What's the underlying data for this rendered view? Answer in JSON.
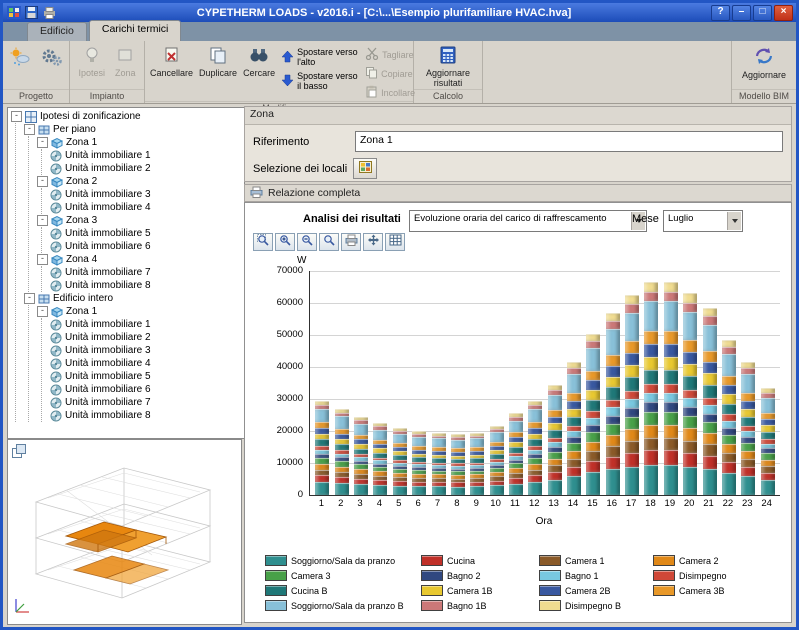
{
  "window": {
    "title": "CYPETHERM LOADS - v2016.i - [C:\\...\\Esempio plurifamiliare HVAC.hva]",
    "controls": {
      "help": "?",
      "minimize": "–",
      "maximize": "□",
      "close": "×"
    }
  },
  "tabs": [
    {
      "label": "Edificio"
    },
    {
      "label": "Carichi termici"
    }
  ],
  "ribbon": {
    "groups": [
      {
        "label": "Progetto"
      },
      {
        "label": "Impianto"
      },
      {
        "label": "Modifica"
      },
      {
        "label": "Calcolo"
      },
      {
        "label": "Modello BIM"
      }
    ],
    "buttons": {
      "ipotesi": "Ipotesi",
      "zona": "Zona",
      "cancellare": "Cancellare",
      "duplicare": "Duplicare",
      "cercare": "Cercare",
      "spostare_alto": "Spostare verso l'alto",
      "spostare_basso": "Spostare verso il basso",
      "tagliare": "Tagliare",
      "copiare": "Copiare",
      "incollare": "Incollare",
      "aggiornare_risultati": "Aggiornare risultati",
      "aggiornare_bim": "Aggiornare"
    }
  },
  "tree": {
    "root": {
      "label": "Ipotesi di zonificazione",
      "children": [
        {
          "label": "Per piano",
          "children": [
            {
              "label": "Zona 1",
              "children": [
                {
                  "label": "Unità immobiliare 1"
                },
                {
                  "label": "Unità immobiliare 2"
                }
              ]
            },
            {
              "label": "Zona 2",
              "children": [
                {
                  "label": "Unità immobiliare 3"
                },
                {
                  "label": "Unità immobiliare 4"
                }
              ]
            },
            {
              "label": "Zona 3",
              "children": [
                {
                  "label": "Unità immobiliare 5"
                },
                {
                  "label": "Unità immobiliare 6"
                }
              ]
            },
            {
              "label": "Zona 4",
              "children": [
                {
                  "label": "Unità immobiliare 7"
                },
                {
                  "label": "Unità immobiliare 8"
                }
              ]
            }
          ]
        },
        {
          "label": "Edificio intero",
          "children": [
            {
              "label": "Zona 1",
              "children": [
                {
                  "label": "Unità immobiliare 1"
                },
                {
                  "label": "Unità immobiliare 2"
                },
                {
                  "label": "Unità immobiliare 3"
                },
                {
                  "label": "Unità immobiliare 4"
                },
                {
                  "label": "Unità immobiliare 5"
                },
                {
                  "label": "Unità immobiliare 6"
                },
                {
                  "label": "Unità immobiliare 7"
                },
                {
                  "label": "Unità immobiliare 8"
                }
              ]
            }
          ]
        }
      ]
    }
  },
  "zona_panel": {
    "header": "Zona",
    "riferimento_label": "Riferimento",
    "riferimento_value": "Zona 1",
    "selezione_label": "Selezione dei locali"
  },
  "report": {
    "section_label": "Relazione completa",
    "analisi_label": "Analisi dei risultati",
    "analisi_value": "Evoluzione oraria del carico di raffrescamento",
    "mese_label": "Mese",
    "mese_value": "Luglio",
    "tools": [
      "zoom-window",
      "zoom-in",
      "zoom-out",
      "zoom-original",
      "print-chart",
      "pan",
      "export"
    ]
  },
  "chart_data": {
    "type": "bar",
    "stacked": true,
    "title": "",
    "ylabel": "W",
    "xlabel": "Ora",
    "ylim": [
      0,
      70000
    ],
    "ytick_step": 10000,
    "grid": true,
    "legend_position": "bottom",
    "categories": [
      1,
      2,
      3,
      4,
      5,
      6,
      7,
      8,
      9,
      10,
      11,
      12,
      13,
      14,
      15,
      16,
      17,
      18,
      19,
      20,
      21,
      22,
      23,
      24
    ],
    "totals": [
      29500,
      27000,
      24500,
      22500,
      21000,
      20000,
      19500,
      19000,
      19500,
      21500,
      25500,
      29500,
      34500,
      41500,
      50500,
      57000,
      62500,
      66500,
      66500,
      63000,
      58500,
      48500,
      41500,
      33500
    ],
    "series": [
      {
        "name": "Soggiorno/Sala da pranzo",
        "color": "#2f8f8f",
        "share": 0.14
      },
      {
        "name": "Cucina",
        "color": "#c03028",
        "share": 0.07
      },
      {
        "name": "Camera 1",
        "color": "#8a5a28",
        "share": 0.06
      },
      {
        "name": "Camera 2",
        "color": "#e08818",
        "share": 0.06
      },
      {
        "name": "Camera 3",
        "color": "#48a048",
        "share": 0.06
      },
      {
        "name": "Bagno 2",
        "color": "#304880",
        "share": 0.045
      },
      {
        "name": "Bagno 1",
        "color": "#78c8e0",
        "share": 0.045
      },
      {
        "name": "Disimpegno",
        "color": "#d04838",
        "share": 0.04
      },
      {
        "name": "Cucina B",
        "color": "#1f7878",
        "share": 0.07
      },
      {
        "name": "Camera 1B",
        "color": "#e8c830",
        "share": 0.06
      },
      {
        "name": "Camera 2B",
        "color": "#3858a0",
        "share": 0.06
      },
      {
        "name": "Camera 3B",
        "color": "#e89828",
        "share": 0.06
      },
      {
        "name": "Soggiorno/Sala da pranzo B",
        "color": "#88c0d8",
        "share": 0.14
      },
      {
        "name": "Bagno 1B",
        "color": "#cc7878",
        "share": 0.045
      },
      {
        "name": "Disimpegno B",
        "color": "#f0dc90",
        "share": 0.045
      }
    ]
  }
}
